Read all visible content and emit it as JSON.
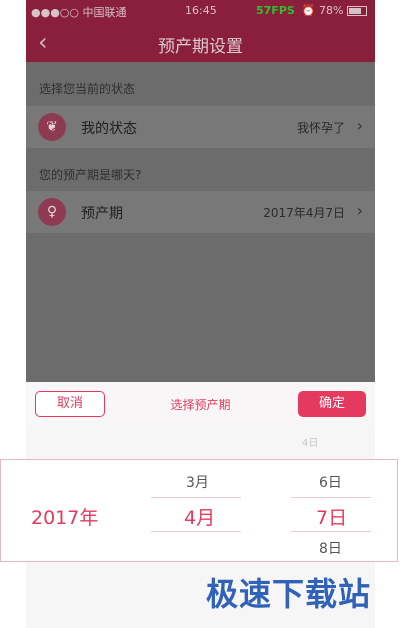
{
  "status_bar": {
    "carrier": "●●●○○ 中国联通",
    "time": "16:45",
    "fps": "57FPS",
    "battery": "78%"
  },
  "nav": {
    "back_icon": "chevron-left-icon",
    "title": "预产期设置"
  },
  "sections": {
    "state_label": "选择您当前的状态",
    "due_label": "您的预产期是哪天?"
  },
  "rows": {
    "state": {
      "label": "我的状态",
      "value": "我怀孕了"
    },
    "due": {
      "label": "预产期",
      "value": "2017年4月7日"
    }
  },
  "picker": {
    "cancel_label": "取消",
    "title": "选择预产期",
    "confirm_label": "确定",
    "faint_day": "4日",
    "year_selected": "2017年",
    "month_prev": "3月",
    "month_selected": "4月",
    "day_prev": "6日",
    "day_selected": "7日",
    "day_next": "8日"
  },
  "watermark": "极速下载站",
  "colors": {
    "header": "#8a1f3c",
    "accent": "#e5395f",
    "watermark": "#2f62b8"
  }
}
